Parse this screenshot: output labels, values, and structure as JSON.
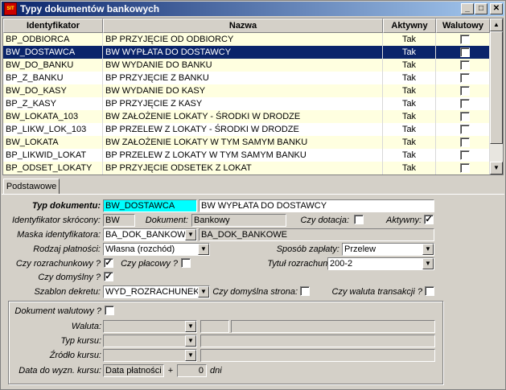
{
  "window": {
    "title": "Typy dokumentów bankowych",
    "app_icon": "app-logo-icon"
  },
  "title_buttons": {
    "minimize": "_",
    "maximize": "□",
    "close": "✕"
  },
  "grid": {
    "headers": {
      "id": "Identyfikator",
      "name": "Nazwa",
      "active": "Aktywny",
      "currency": "Walutowy"
    },
    "rows": [
      {
        "id": "BP_ODBIORCA",
        "name": "BP PRZYJĘCIE OD ODBIORCY",
        "active": "Tak",
        "currency": ""
      },
      {
        "id": "BW_DOSTAWCA",
        "name": "BW WYPŁATA DO DOSTAWCY",
        "active": "Tak",
        "currency": ""
      },
      {
        "id": "BW_DO_BANKU",
        "name": "BW WYDANIE DO BANKU",
        "active": "Tak",
        "currency": ""
      },
      {
        "id": "BP_Z_BANKU",
        "name": "BP PRZYJĘCIE Z BANKU",
        "active": "Tak",
        "currency": ""
      },
      {
        "id": "BW_DO_KASY",
        "name": "BW WYDANIE DO KASY",
        "active": "Tak",
        "currency": ""
      },
      {
        "id": "BP_Z_KASY",
        "name": "BP PRZYJĘCIE Z KASY",
        "active": "Tak",
        "currency": ""
      },
      {
        "id": "BW_LOKATA_103",
        "name": "BW ZAŁOŻENIE LOKATY - ŚRODKI W DRODZE",
        "active": "Tak",
        "currency": ""
      },
      {
        "id": "BP_LIKW_LOK_103",
        "name": "BP PRZELEW Z LOKATY - ŚRODKI W DRODZE",
        "active": "Tak",
        "currency": ""
      },
      {
        "id": "BW_LOKATA",
        "name": "BW ZAŁOŻENIE LOKATY W TYM SAMYM BANKU",
        "active": "Tak",
        "currency": ""
      },
      {
        "id": "BP_LIKWID_LOKAT",
        "name": "BP PRZELEW Z LOKATY W TYM SAMYM BANKU",
        "active": "Tak",
        "currency": ""
      },
      {
        "id": "BP_ODSET_LOKATY",
        "name": "BP PRZYJĘCIE ODSETEK Z LOKAT",
        "active": "Tak",
        "currency": ""
      }
    ]
  },
  "tab": {
    "label": "Podstawowe"
  },
  "form": {
    "typ_dokumentu_label": "Typ dokumentu:",
    "typ_dokumentu_id": "BW_DOSTAWCA",
    "typ_dokumentu_name": "BW WYPŁATA DO DOSTAWCY",
    "ident_skrocony_label": "Identyfikator skrócony:",
    "ident_skrocony": "BW",
    "dokument_label": "Dokument:",
    "dokument": "Bankowy",
    "czy_dotacja_label": "Czy dotacja:",
    "czy_dotacja": "",
    "aktywny_label": "Aktywny:",
    "aktywny": "✓",
    "maska_label": "Maska identyfikatora:",
    "maska_select": "BA_DOK_BANKOW",
    "maska_value": "BA_DOK_BANKOWE",
    "rodzaj_label": "Rodzaj płatności:",
    "rodzaj": "Własna (rozchód)",
    "sposob_label": "Sposób zapłaty:",
    "sposob": "Przelew",
    "czy_rozrach_label": "Czy rozrachunkowy ?",
    "czy_rozrach": "✓",
    "czy_placowy_label": "Czy płacowy ?",
    "czy_placowy": "",
    "tytul_label": "Tytuł rozrachunku:",
    "tytul": "200-2",
    "czy_domyslny_label": "Czy domyślny ?",
    "czy_domyslny": "✓",
    "szablon_label": "Szablon dekretu:",
    "szablon": "WYD_ROZRACHUNEK",
    "czy_dom_strona_label": "Czy domyślna strona:",
    "czy_dom_strona": "",
    "czy_waluta_tr_label": "Czy waluta transakcji ?",
    "czy_waluta_tr": "",
    "dok_walutowy_label": "Dokument walutowy ?",
    "dok_walutowy": "",
    "waluta_label": "Waluta:",
    "typ_kursu_label": "Typ kursu:",
    "zrodlo_kursu_label": "Źródło kursu:",
    "data_kursu_label": "Data do wyzn. kursu:",
    "data_kursu": "Data płatności",
    "plus": "+",
    "dni_value": "0",
    "dni_label": "dni"
  },
  "colors": {
    "titlebar": "#0a246a",
    "selection": "#0a246a",
    "highlight_field": "#00ffff",
    "row_alt": "#ffffe0"
  }
}
